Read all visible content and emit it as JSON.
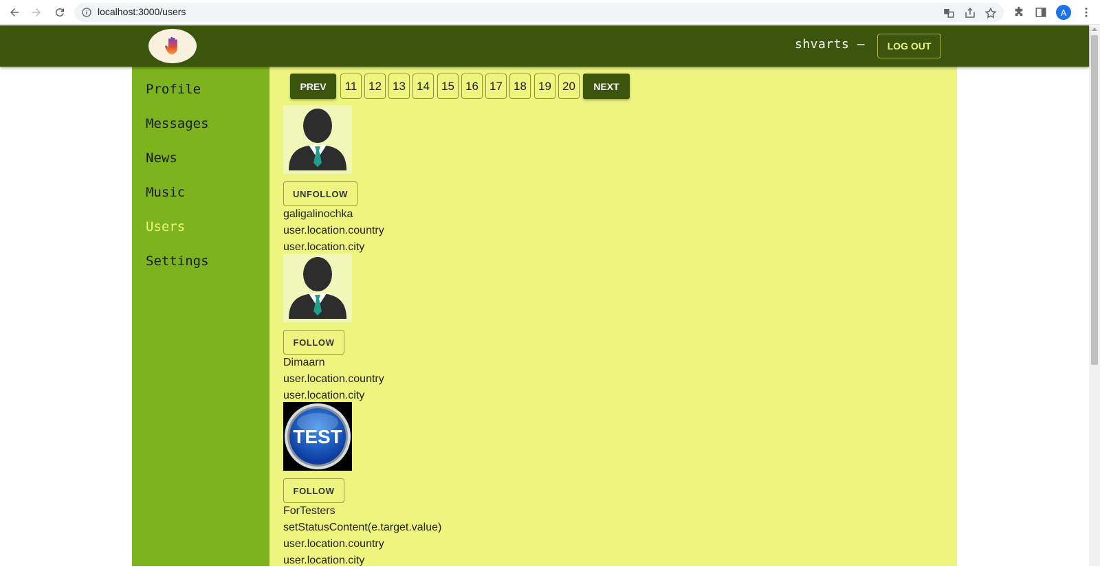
{
  "browser": {
    "url": "localhost:3000/users",
    "profile_initial": "A"
  },
  "header": {
    "username": "shvarts –",
    "logout_label": "LOG OUT",
    "logo_icon": "hand-icon"
  },
  "sidebar": {
    "items": [
      {
        "label": "Profile"
      },
      {
        "label": "Messages"
      },
      {
        "label": "News"
      },
      {
        "label": "Music"
      },
      {
        "label": "Users",
        "active": true
      },
      {
        "label": "Settings"
      }
    ]
  },
  "pagination": {
    "prev_label": "PREV",
    "next_label": "NEXT",
    "pages": [
      "11",
      "12",
      "13",
      "14",
      "15",
      "16",
      "17",
      "18",
      "19",
      "20"
    ]
  },
  "users": [
    {
      "avatar": "default-avatar-icon",
      "button_label": "UNFOLLOW",
      "name": "galigalinochka",
      "country": "user.location.country",
      "city": "user.location.city"
    },
    {
      "avatar": "default-avatar-icon",
      "button_label": "FOLLOW",
      "name": "Dimaarn",
      "country": "user.location.country",
      "city": "user.location.city"
    },
    {
      "avatar": "test-badge-image",
      "avatar_text": "TEST",
      "button_label": "FOLLOW",
      "name": "ForTesters",
      "status": "setStatusContent(e.target.value)",
      "country": "user.location.country",
      "city": "user.location.city"
    }
  ],
  "colors": {
    "header_bg": "#3c550d",
    "sidebar_bg": "#7db31f",
    "content_bg": "#edf57e",
    "active_link": "#ecf77b"
  }
}
